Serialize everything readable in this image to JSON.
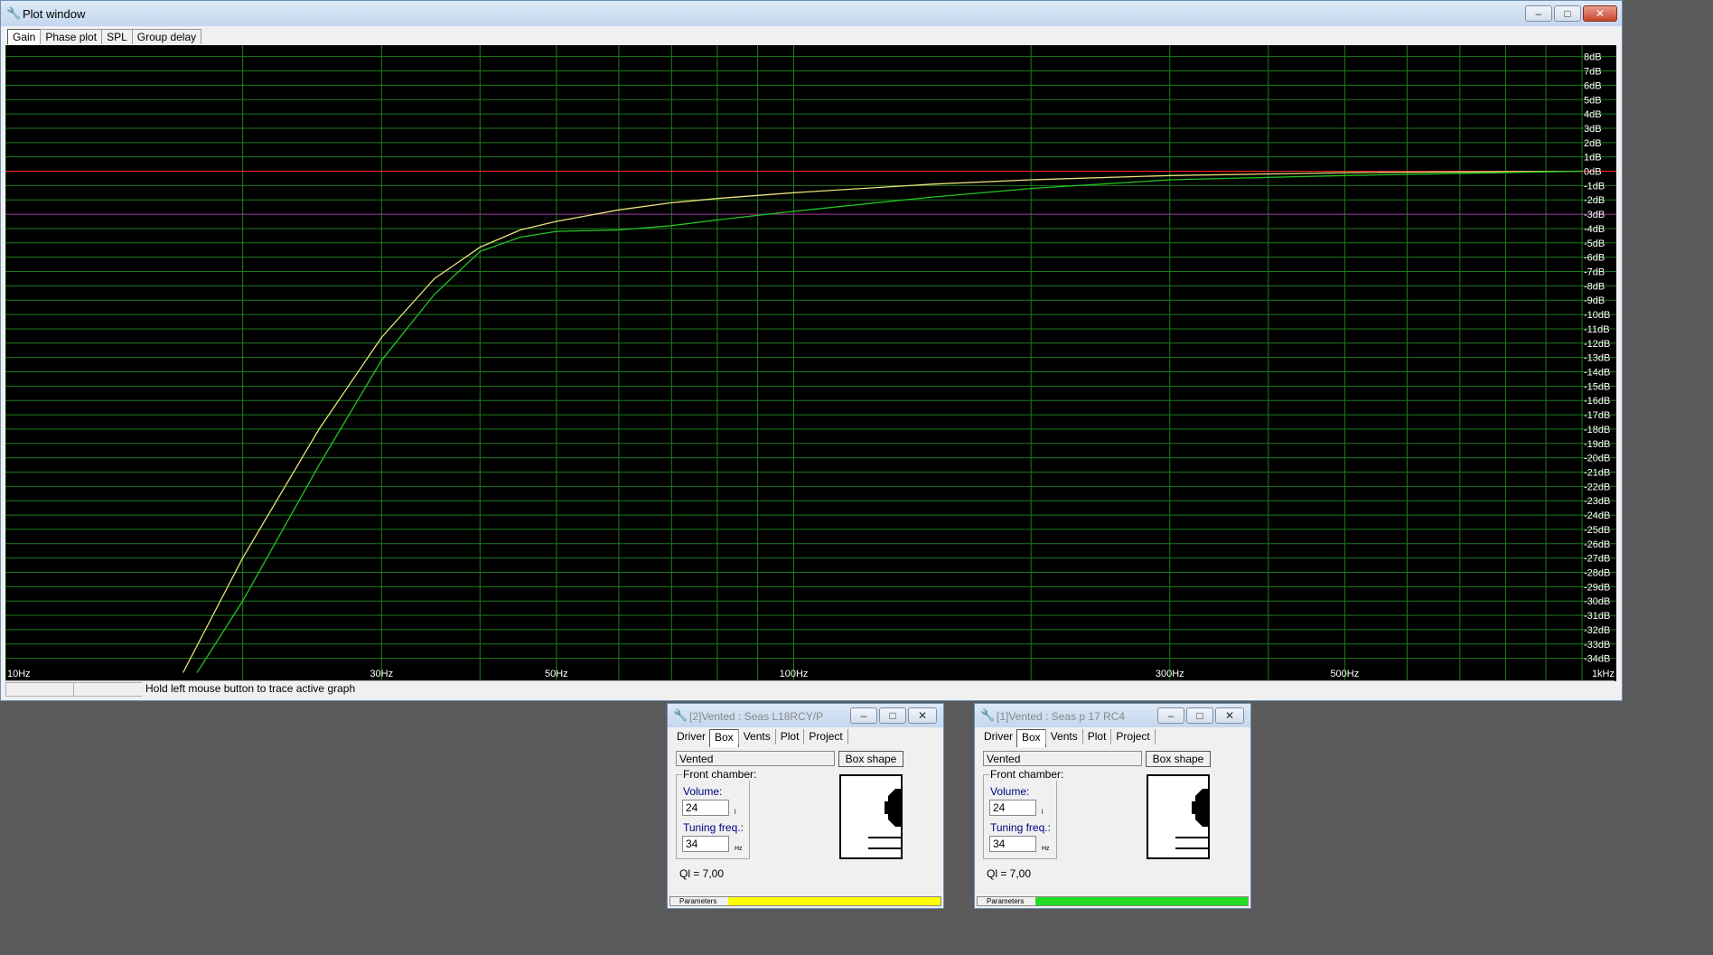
{
  "plot_window": {
    "title": "Plot window",
    "tabs": [
      "Gain",
      "Phase plot",
      "SPL",
      "Group delay"
    ],
    "active_tab": "Gain",
    "status": {
      "hint": "Hold left mouse button to trace active graph"
    }
  },
  "chart_data": {
    "type": "line",
    "x_scale": "log",
    "xlim": [
      10,
      1000
    ],
    "ylim": [
      -35,
      9
    ],
    "x_ticks": [
      {
        "value": 10,
        "label": "10Hz"
      },
      {
        "value": 30,
        "label": "30Hz"
      },
      {
        "value": 50,
        "label": "50Hz"
      },
      {
        "value": 100,
        "label": "100Hz"
      },
      {
        "value": 300,
        "label": "300Hz"
      },
      {
        "value": 500,
        "label": "500Hz"
      },
      {
        "value": 1000,
        "label": "1kHz"
      }
    ],
    "x_gridlines": [
      10,
      20,
      30,
      40,
      50,
      60,
      70,
      80,
      90,
      100,
      200,
      300,
      400,
      500,
      600,
      700,
      800,
      900,
      1000
    ],
    "y_ticks": [
      "8dB",
      "7dB",
      "6dB",
      "5dB",
      "4dB",
      "3dB",
      "2dB",
      "1dB",
      "0dB",
      "-1dB",
      "-2dB",
      "-3dB",
      "-4dB",
      "-5dB",
      "-6dB",
      "-7dB",
      "-8dB",
      "-9dB",
      "-10dB",
      "-11dB",
      "-12dB",
      "-13dB",
      "-14dB",
      "-15dB",
      "-16dB",
      "-17dB",
      "-18dB",
      "-19dB",
      "-20dB",
      "-21dB",
      "-22dB",
      "-23dB",
      "-24dB",
      "-25dB",
      "-26dB",
      "-27dB",
      "-28dB",
      "-29dB",
      "-30dB",
      "-31dB",
      "-32dB",
      "-33dB",
      "-34dB"
    ],
    "grid": true,
    "reference_line": {
      "y": 0,
      "color": "#ff2a2a"
    },
    "marker_line": {
      "y": -3,
      "color": "#a020a0"
    },
    "series": [
      {
        "color": "#e8e27a",
        "points": [
          [
            16.8,
            -35
          ],
          [
            20,
            -27
          ],
          [
            25,
            -18
          ],
          [
            30,
            -11.6
          ],
          [
            35,
            -7.5
          ],
          [
            40,
            -5.3
          ],
          [
            45,
            -4.1
          ],
          [
            50,
            -3.5
          ],
          [
            60,
            -2.7
          ],
          [
            70,
            -2.2
          ],
          [
            80,
            -1.9
          ],
          [
            100,
            -1.5
          ],
          [
            150,
            -0.9
          ],
          [
            200,
            -0.6
          ],
          [
            300,
            -0.3
          ],
          [
            500,
            -0.1
          ],
          [
            1000,
            0
          ]
        ]
      },
      {
        "color": "#22c422",
        "points": [
          [
            17.5,
            -35
          ],
          [
            20,
            -30
          ],
          [
            25,
            -20.5
          ],
          [
            30,
            -13.2
          ],
          [
            35,
            -8.6
          ],
          [
            40,
            -5.6
          ],
          [
            45,
            -4.6
          ],
          [
            50,
            -4.2
          ],
          [
            60,
            -4.1
          ],
          [
            70,
            -3.8
          ],
          [
            80,
            -3.4
          ],
          [
            100,
            -2.8
          ],
          [
            150,
            -1.8
          ],
          [
            200,
            -1.2
          ],
          [
            300,
            -0.6
          ],
          [
            500,
            -0.3
          ],
          [
            1000,
            0
          ]
        ]
      }
    ]
  },
  "driver_windows": [
    {
      "title": "[2]Vented : Seas L18RCY/P",
      "tabs": [
        "Driver",
        "Box",
        "Vents",
        "Plot",
        "Project"
      ],
      "active_tab": "Box",
      "box_type": "Vented",
      "box_shape_label": "Box shape",
      "group_label": "Front chamber:",
      "volume_label": "Volume:",
      "volume_value": "24",
      "volume_unit": "l",
      "tuning_label": "Tuning freq.:",
      "tuning_value": "34",
      "tuning_unit": "Hz",
      "ql": "Ql = 7,00",
      "parameters_label": "Parameters",
      "color": "#ffff00"
    },
    {
      "title": "[1]Vented : Seas p 17 RC4",
      "tabs": [
        "Driver",
        "Box",
        "Vents",
        "Plot",
        "Project"
      ],
      "active_tab": "Box",
      "box_type": "Vented",
      "box_shape_label": "Box shape",
      "group_label": "Front chamber:",
      "volume_label": "Volume:",
      "volume_value": "24",
      "volume_unit": "l",
      "tuning_label": "Tuning freq.:",
      "tuning_value": "34",
      "tuning_unit": "Hz",
      "ql": "Ql = 7,00",
      "parameters_label": "Parameters",
      "color": "#22dd22"
    }
  ]
}
